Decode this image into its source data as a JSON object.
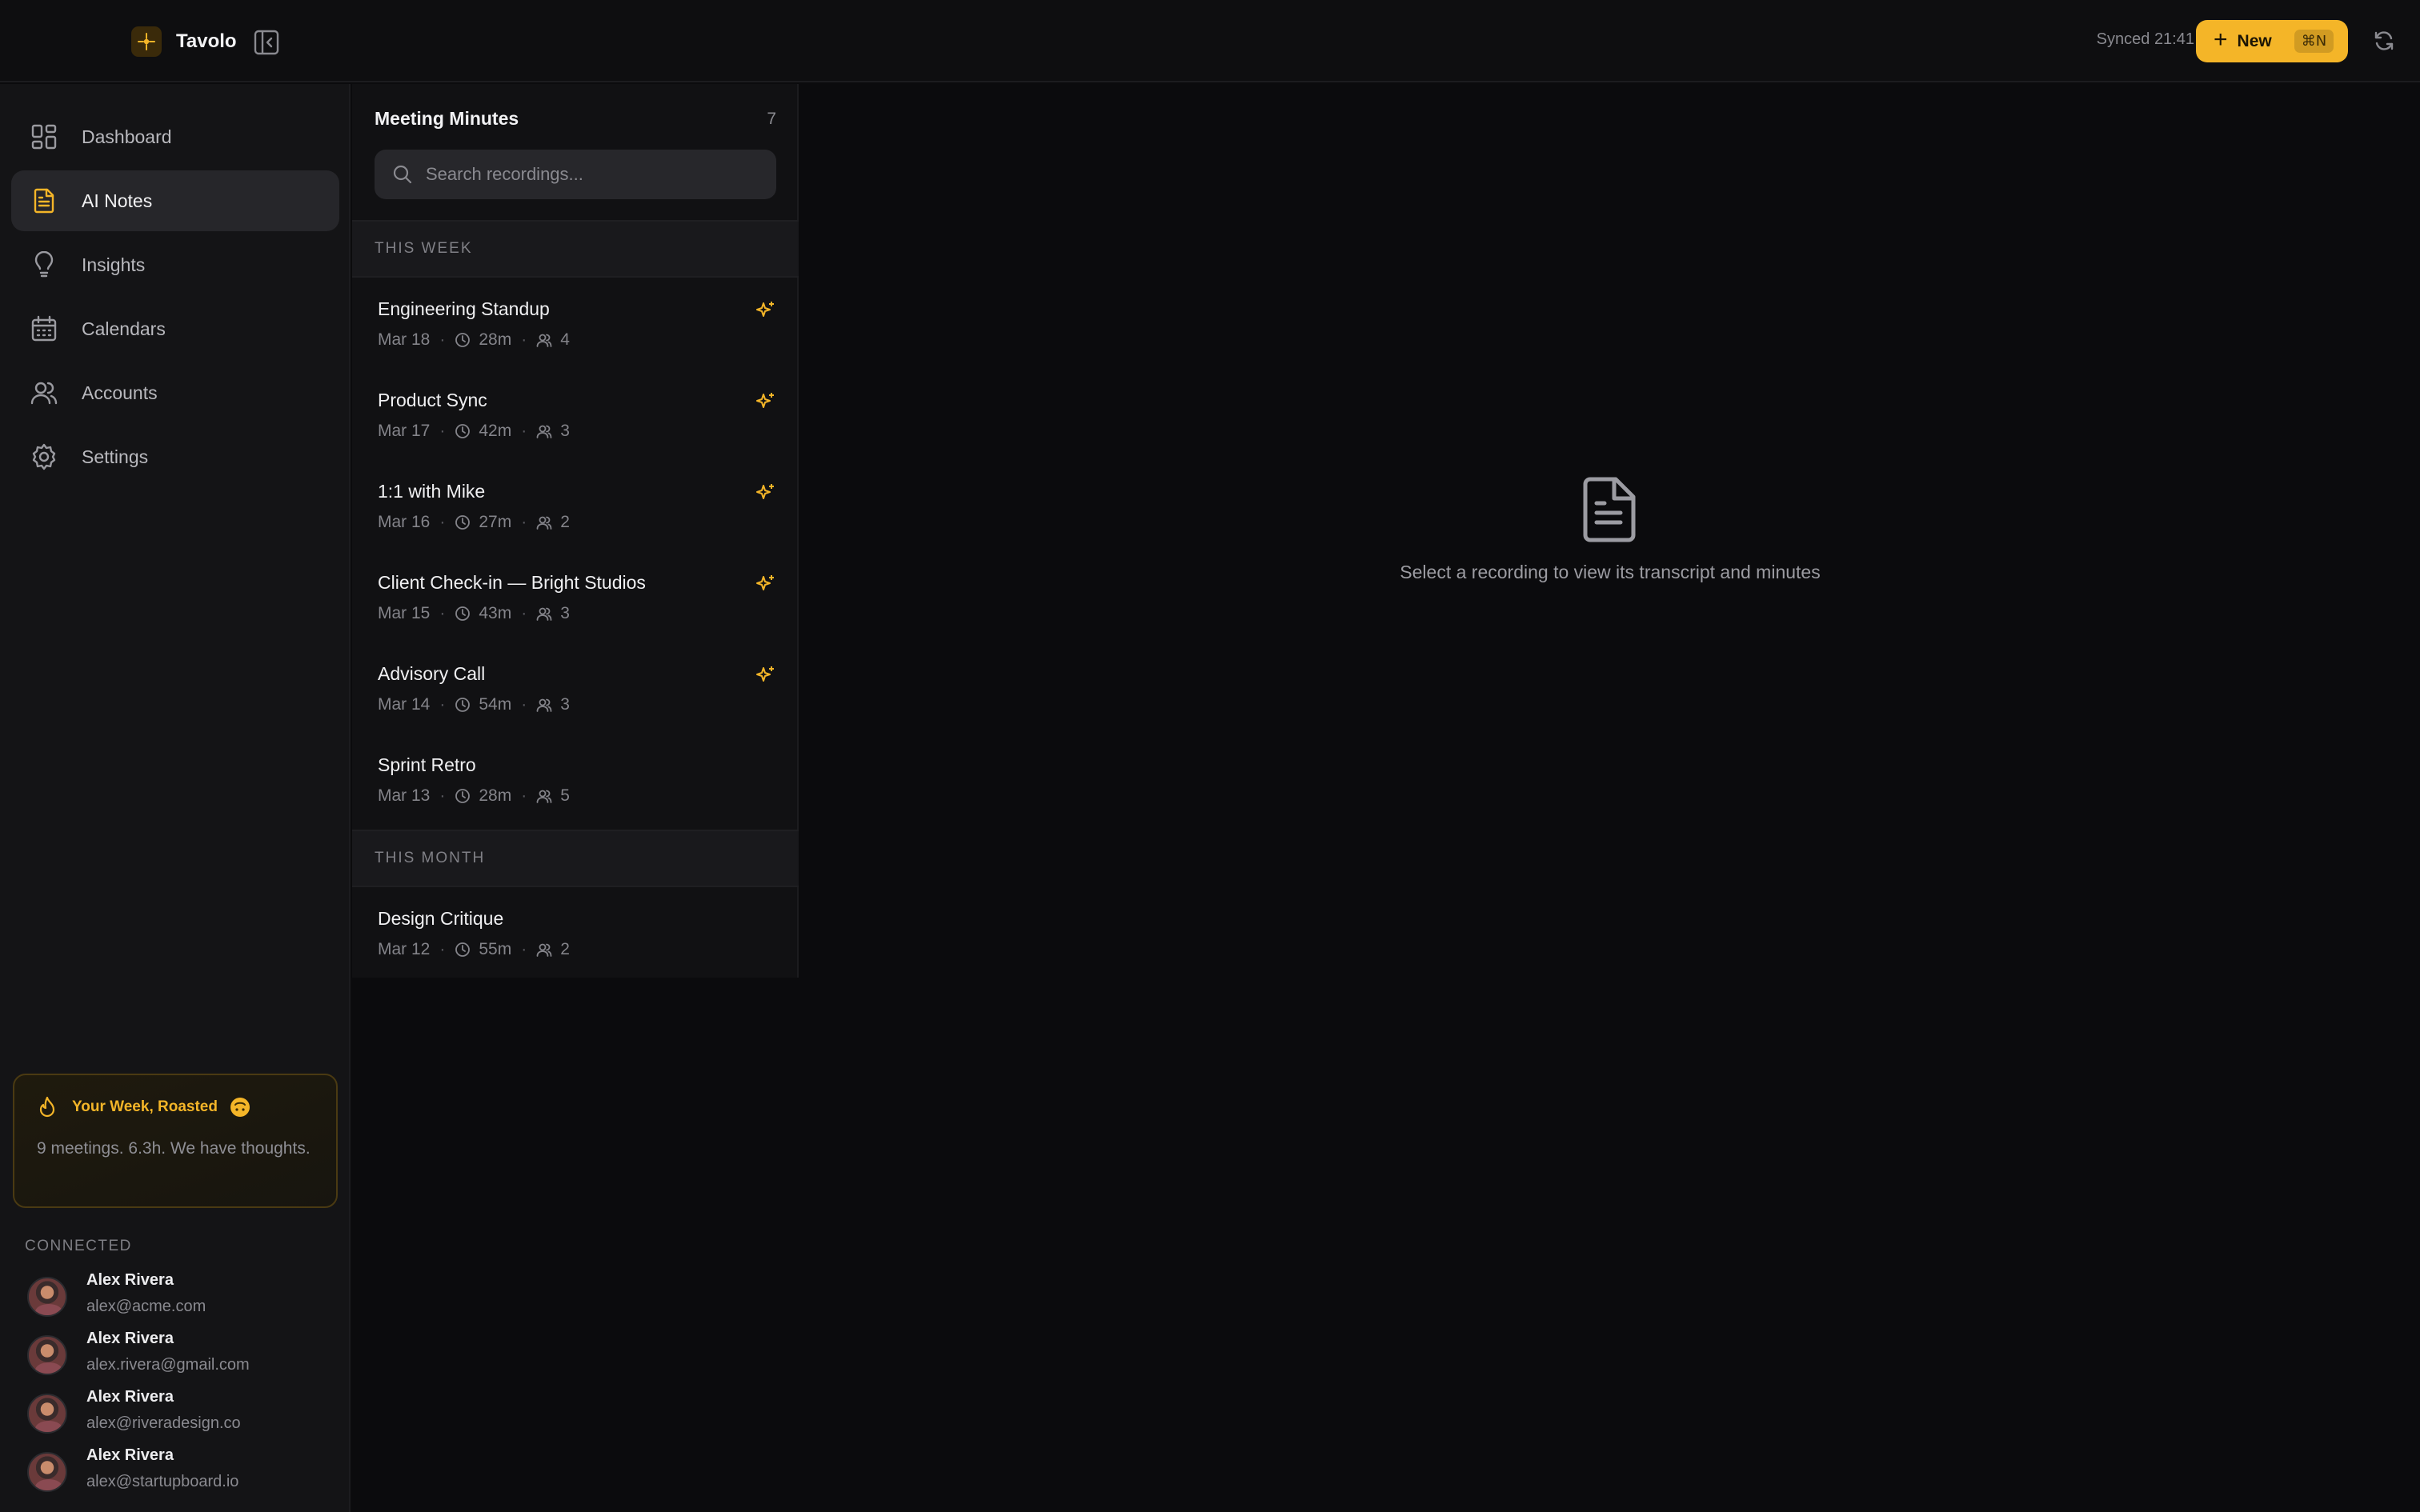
{
  "app": {
    "name": "Tavolo",
    "synced_text": "Synced 21:41"
  },
  "toolbar": {
    "new_label": "New",
    "new_shortcut": "⌘N",
    "accent": "#f4b528"
  },
  "sidebar": {
    "items": [
      {
        "label": "Dashboard",
        "icon": "dashboard-icon"
      },
      {
        "label": "AI Notes",
        "icon": "notes-icon",
        "active": true
      },
      {
        "label": "Insights",
        "icon": "lightbulb-icon"
      },
      {
        "label": "Calendars",
        "icon": "calendar-icon"
      },
      {
        "label": "Accounts",
        "icon": "users-icon"
      },
      {
        "label": "Settings",
        "icon": "gear-icon"
      }
    ],
    "roast": {
      "title": "Your Week, Roasted",
      "body": "9 meetings. 6.3h. We have thoughts."
    },
    "connected_label": "CONNECTED",
    "accounts": [
      {
        "name": "Alex Rivera",
        "email": "alex@acme.com"
      },
      {
        "name": "Alex Rivera",
        "email": "alex.rivera@gmail.com"
      },
      {
        "name": "Alex Rivera",
        "email": "alex@riveradesign.co"
      },
      {
        "name": "Alex Rivera",
        "email": "alex@startupboard.io"
      }
    ]
  },
  "list": {
    "title": "Meeting Minutes",
    "count": "7",
    "search_placeholder": "Search recordings...",
    "groups": [
      {
        "label": "THIS WEEK",
        "rows": [
          {
            "title": "Engineering Standup",
            "date": "Mar 18",
            "duration": "28m",
            "attendees": "4",
            "ai": true
          },
          {
            "title": "Product Sync",
            "date": "Mar 17",
            "duration": "42m",
            "attendees": "3",
            "ai": true
          },
          {
            "title": "1:1 with Mike",
            "date": "Mar 16",
            "duration": "27m",
            "attendees": "2",
            "ai": true
          },
          {
            "title": "Client Check-in — Bright Studios",
            "date": "Mar 15",
            "duration": "43m",
            "attendees": "3",
            "ai": true
          },
          {
            "title": "Advisory Call",
            "date": "Mar 14",
            "duration": "54m",
            "attendees": "3",
            "ai": true
          },
          {
            "title": "Sprint Retro",
            "date": "Mar 13",
            "duration": "28m",
            "attendees": "5",
            "ai": false
          }
        ]
      },
      {
        "label": "THIS MONTH",
        "rows": [
          {
            "title": "Design Critique",
            "date": "Mar 12",
            "duration": "55m",
            "attendees": "2",
            "ai": false
          }
        ]
      }
    ]
  },
  "detail": {
    "empty_text": "Select a recording to view its transcript and minutes"
  }
}
